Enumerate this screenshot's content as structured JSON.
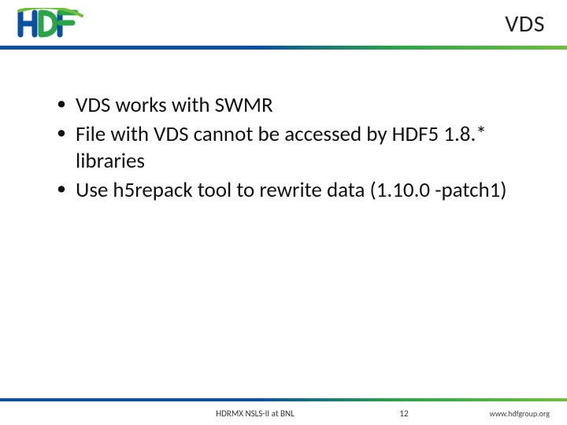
{
  "header": {
    "logo_text": "HDF",
    "title": "VDS"
  },
  "bullets": [
    "VDS works with SWMR",
    "File with VDS cannot be accessed by HDF5 1.8.* libraries",
    "Use h5repack tool to rewrite data (1.10.0 -patch1)"
  ],
  "footer": {
    "left": "HDRMX NSLS-II at BNL",
    "page": "12",
    "url": "www.hdfgroup.org"
  },
  "colors": {
    "blue": "#0a4fa0",
    "green": "#2aa44a",
    "lime": "#6fbf3f"
  }
}
